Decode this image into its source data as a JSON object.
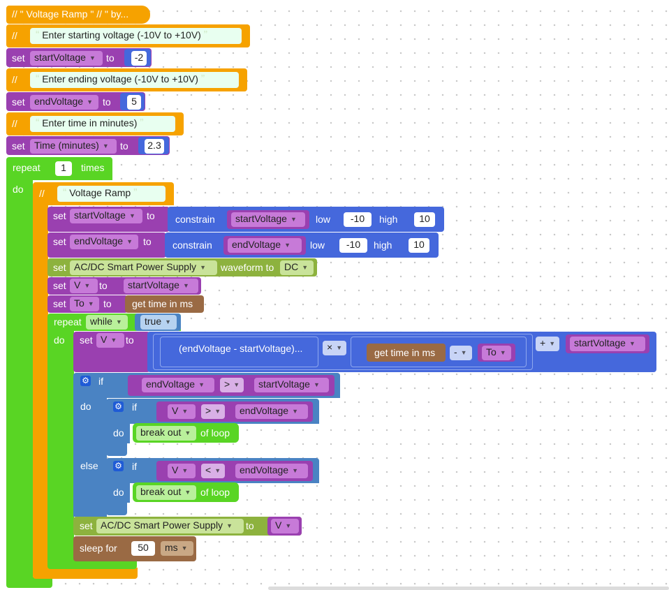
{
  "header": {
    "comment": "// \" Voltage Ramp \" // \" by..."
  },
  "comment1": {
    "slash": "//",
    "text": "Enter starting voltage (-10V to +10V)"
  },
  "set_start": {
    "set": "set",
    "var": "startVoltage",
    "to": "to",
    "value": "-2"
  },
  "comment2": {
    "slash": "//",
    "text": "Enter ending voltage (-10V to +10V)"
  },
  "set_end": {
    "set": "set",
    "var": "endVoltage",
    "to": "to",
    "value": "5"
  },
  "comment3": {
    "slash": "//",
    "text": "Enter time in minutes)"
  },
  "set_time": {
    "set": "set",
    "var": "Time (minutes)",
    "to": "to",
    "value": "2.3"
  },
  "repeat": {
    "repeat": "repeat",
    "count": "1",
    "times": "times",
    "do": "do"
  },
  "comment4": {
    "slash": "//",
    "text": "Voltage Ramp"
  },
  "constrain_start": {
    "set": "set",
    "var": "startVoltage",
    "to": "to",
    "constrain": "constrain",
    "arg": "startVoltage",
    "low": "low",
    "low_val": "-10",
    "high": "high",
    "high_val": "10"
  },
  "constrain_end": {
    "set": "set",
    "var": "endVoltage",
    "to": "to",
    "constrain": "constrain",
    "arg": "endVoltage",
    "low": "low",
    "low_val": "-10",
    "high": "high",
    "high_val": "10"
  },
  "waveform": {
    "set": "set",
    "device": "AC/DC Smart Power Supply",
    "label": "waveform to",
    "value": "DC"
  },
  "set_v": {
    "set": "set",
    "var": "V",
    "to": "to",
    "value": "startVoltage"
  },
  "set_to": {
    "set": "set",
    "var": "To",
    "to": "to",
    "value": "get time in ms"
  },
  "while": {
    "repeat": "repeat",
    "mode": "while",
    "cond": "true",
    "do": "do"
  },
  "set_v2": {
    "set": "set",
    "var": "V",
    "to": "to",
    "expr": "(endVoltage - startVoltage)...",
    "times_op": "×",
    "get_time": "get time in ms",
    "minus_op": "-",
    "to_var": "To",
    "plus_op": "+",
    "start": "startVoltage"
  },
  "if_outer": {
    "if": "if",
    "a": "endVoltage",
    "op": ">",
    "b": "startVoltage",
    "do": "do",
    "else": "else"
  },
  "if_inner1": {
    "if": "if",
    "a": "V",
    "op": ">",
    "b": "endVoltage",
    "do": "do",
    "break": "break out",
    "of_loop": "of loop"
  },
  "if_inner2": {
    "if": "if",
    "a": "V",
    "op": "<",
    "b": "endVoltage",
    "do": "do",
    "break": "break out",
    "of_loop": "of loop"
  },
  "set_supply": {
    "set": "set",
    "device": "AC/DC Smart Power Supply",
    "to": "to",
    "var": "V"
  },
  "sleep": {
    "label": "sleep for",
    "value": "50",
    "unit": "ms"
  }
}
